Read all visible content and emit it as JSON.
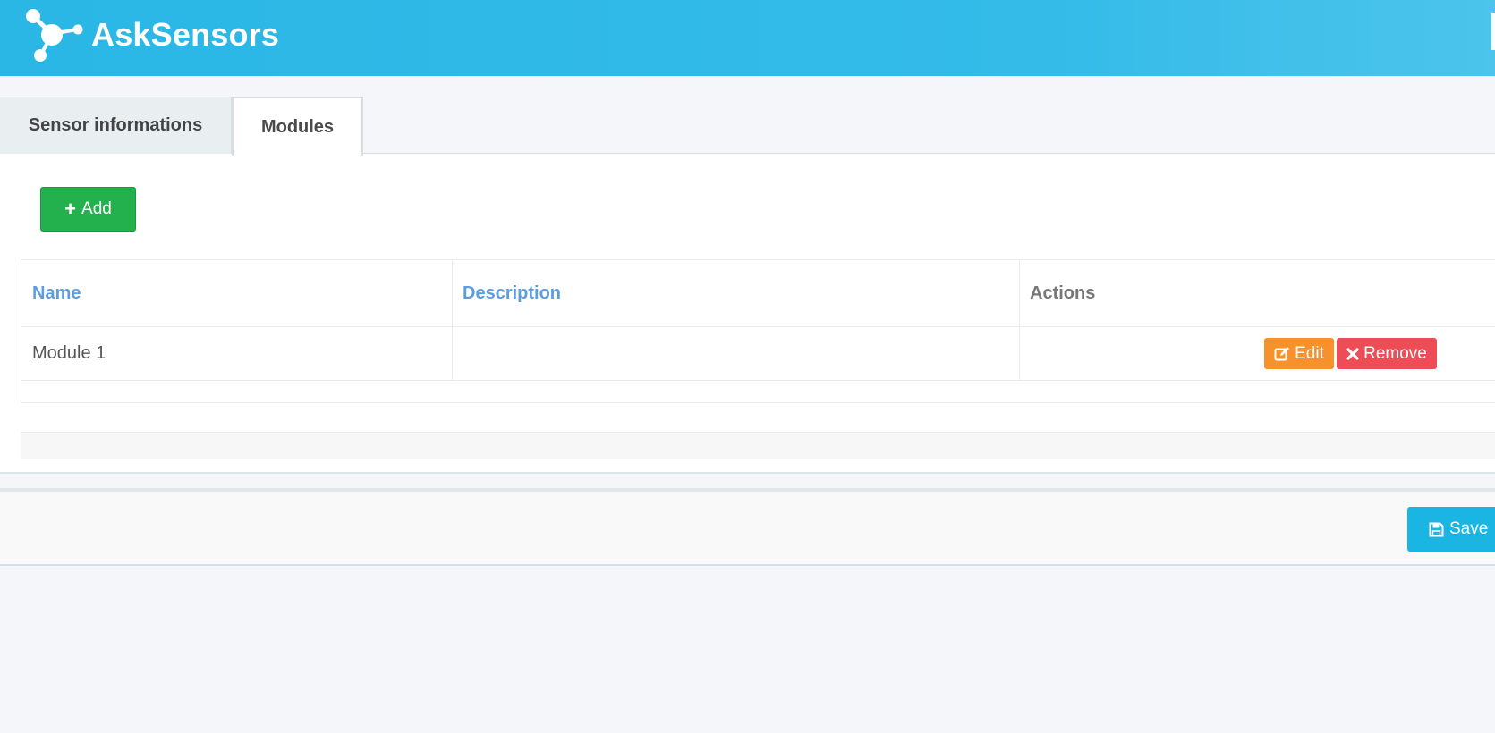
{
  "header": {
    "brand": "AskSensors",
    "logo_icon": "molecule-network-icon",
    "accent_color": "#2ab7e6"
  },
  "tabs": [
    {
      "label": "Sensor informations",
      "active": false
    },
    {
      "label": "Modules",
      "active": true
    }
  ],
  "toolbar": {
    "add_label": "Add",
    "add_icon": "plus-icon",
    "add_color": "#22b14c"
  },
  "table": {
    "columns": [
      "Name",
      "Description",
      "Actions"
    ],
    "rows": [
      {
        "name": "Module 1",
        "description": ""
      }
    ],
    "edit_label": "Edit",
    "edit_icon": "edit-icon",
    "edit_color": "#f7912c",
    "remove_label": "Remove",
    "remove_icon": "times-icon",
    "remove_color": "#ee4c57"
  },
  "footer": {
    "save_label": "Save",
    "save_icon": "floppy-disk-icon",
    "save_color": "#1ab5e3"
  }
}
